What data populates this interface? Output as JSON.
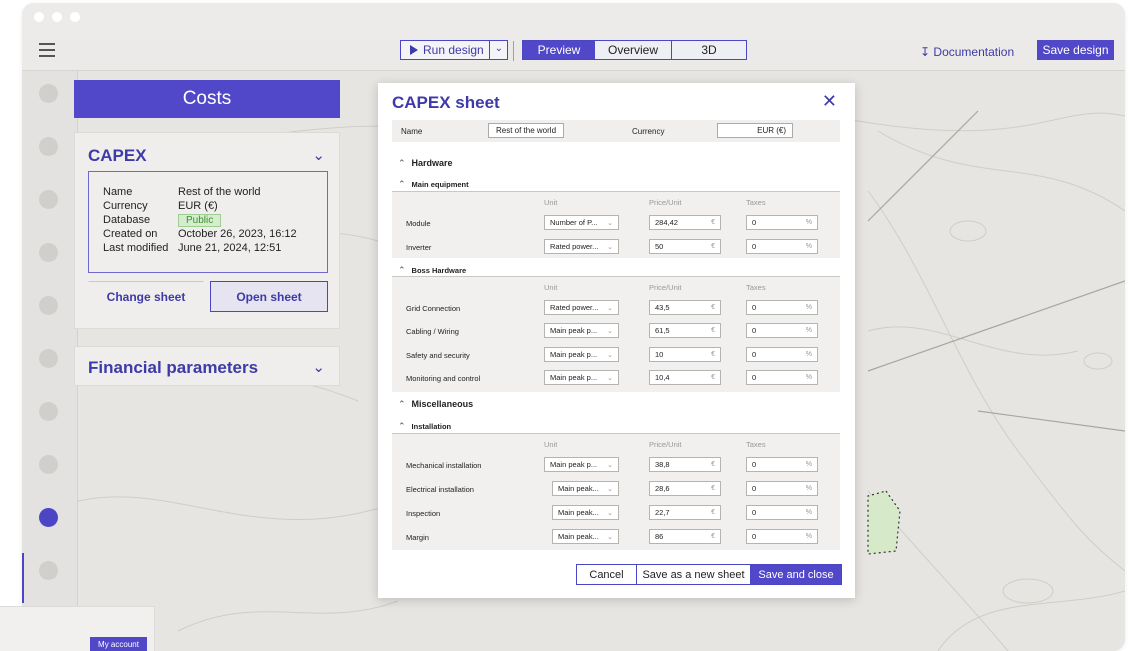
{
  "toolbar": {
    "run_design": "Run design",
    "view_tabs": [
      "Preview",
      "Overview",
      "3D"
    ],
    "documentation": "Documentation",
    "save_design": "Save design"
  },
  "colors": {
    "accent": "#5147c9",
    "map_bg": "#e7e5e1",
    "map_lines": "#cfcdc8",
    "public_badge": "#d5ecce"
  },
  "icons": [
    "menu-icon",
    "play-icon",
    "chevron-down-icon",
    "download-icon",
    "close-icon",
    "caret-up-icon"
  ],
  "left_panel": {
    "title": "Costs",
    "capex": {
      "title": "CAPEX",
      "info": [
        {
          "key": "Name",
          "value": "Rest of the world"
        },
        {
          "key": "Currency",
          "value": "EUR (€)"
        },
        {
          "key": "Database",
          "value": "Public"
        },
        {
          "key": "Created on",
          "value": "October 26, 2023, 16:12"
        },
        {
          "key": "Last modified",
          "value": "June 21, 2024, 12:51"
        }
      ],
      "change_sheet": "Change sheet",
      "open_sheet": "Open sheet"
    },
    "financial_parameters": "Financial parameters"
  },
  "account": {
    "my_account": "My account"
  },
  "modal": {
    "title": "CAPEX sheet",
    "name_label": "Name",
    "name_value": "Rest of the world",
    "currency_label": "Currency",
    "currency_value": "EUR (€)",
    "columns": {
      "unit": "Unit",
      "price": "Price/Unit",
      "taxes": "Taxes"
    },
    "hardware": {
      "title": "Hardware",
      "main_equipment": {
        "title": "Main equipment",
        "rows": [
          {
            "label": "Module",
            "unit": "Number of P...",
            "price": "284,42",
            "taxes": "0"
          },
          {
            "label": "Inverter",
            "unit": "Rated power...",
            "price": "50",
            "taxes": "0"
          }
        ]
      },
      "boss_hardware": {
        "title": "Boss Hardware",
        "rows": [
          {
            "label": "Grid Connection",
            "unit": "Rated power...",
            "price": "43,5",
            "taxes": "0"
          },
          {
            "label": "Cabling / Wiring",
            "unit": "Main peak p...",
            "price": "61,5",
            "taxes": "0"
          },
          {
            "label": "Safety and security",
            "unit": "Main peak p...",
            "price": "10",
            "taxes": "0"
          },
          {
            "label": "Monitoring and control",
            "unit": "Main peak p...",
            "price": "10,4",
            "taxes": "0"
          }
        ]
      }
    },
    "miscellaneous": {
      "title": "Miscellaneous",
      "installation": {
        "title": "Installation",
        "rows": [
          {
            "label": "Mechanical installation",
            "unit": "Main peak p...",
            "price": "38,8",
            "taxes": "0"
          },
          {
            "label": "Electrical installation",
            "unit": "Main peak...",
            "price": "28,6",
            "taxes": "0"
          },
          {
            "label": "Inspection",
            "unit": "Main peak...",
            "price": "22,7",
            "taxes": "0"
          },
          {
            "label": "Margin",
            "unit": "Main peak...",
            "price": "86",
            "taxes": "0"
          }
        ]
      }
    },
    "currency_suffix": "€",
    "percent_suffix": "%",
    "cancel": "Cancel",
    "save_new": "Save as a new sheet",
    "save_close": "Save and close"
  }
}
